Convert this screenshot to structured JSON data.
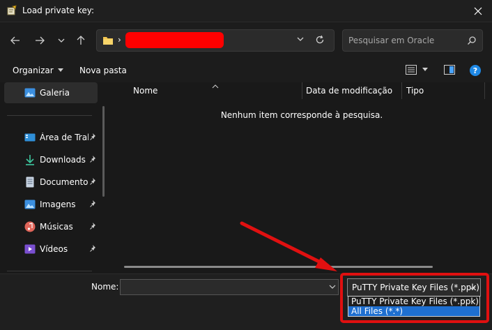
{
  "window": {
    "title": "Load private key:",
    "close_icon": "close-icon"
  },
  "nav": {
    "back_icon": "arrow-left-icon",
    "forward_icon": "arrow-right-icon",
    "recent_icon": "chevron-down-icon",
    "up_icon": "arrow-up-icon",
    "breadcrumb_separator": "›",
    "refresh_icon": "refresh-icon"
  },
  "search": {
    "placeholder": "Pesquisar em Oracle"
  },
  "commands": {
    "organize": "Organizar",
    "new_folder": "Nova pasta",
    "help": "?"
  },
  "sidebar": {
    "gallery": "Galeria",
    "items": [
      {
        "label": "Área de Traba",
        "icon": "desktop-icon"
      },
      {
        "label": "Downloads",
        "icon": "download-icon"
      },
      {
        "label": "Documentos",
        "icon": "document-icon"
      },
      {
        "label": "Imagens",
        "icon": "image-icon"
      },
      {
        "label": "Músicas",
        "icon": "music-icon"
      },
      {
        "label": "Vídeos",
        "icon": "video-icon"
      }
    ]
  },
  "filelist": {
    "columns": [
      "Nome",
      "Data de modificação",
      "Tipo"
    ],
    "empty_message": "Nenhum item corresponde à pesquisa."
  },
  "footer": {
    "name_label": "Nome:",
    "name_value": "",
    "filter_selected": "PuTTY Private Key Files (*.ppk)",
    "filter_options": [
      "PuTTY Private Key Files (*.ppk)",
      "All Files (*.*)"
    ]
  },
  "colors": {
    "annotation_red": "#e01010",
    "selection_blue": "#1e6fd0",
    "redaction": "#ff0000"
  }
}
